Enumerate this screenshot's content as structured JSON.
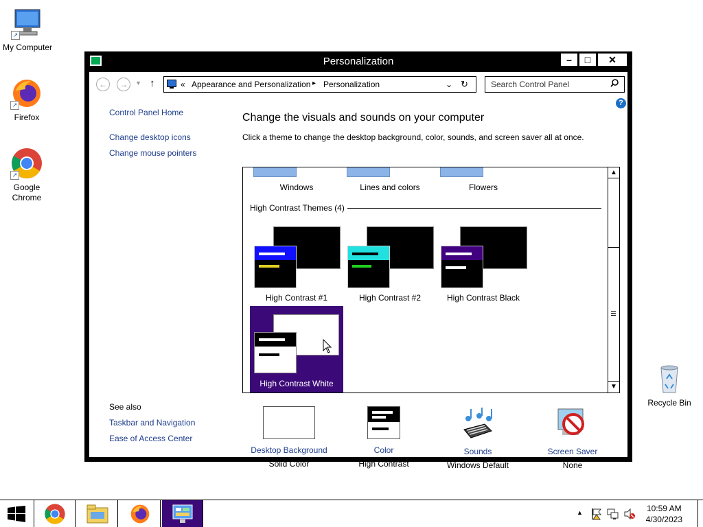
{
  "desktop": {
    "icons": [
      {
        "label": "My Computer"
      },
      {
        "label": "Firefox"
      },
      {
        "label": "Google Chrome"
      },
      {
        "label": "Recycle Bin"
      }
    ]
  },
  "window": {
    "title": "Personalization",
    "controls": {
      "minimize": "–",
      "maximize": "□",
      "close": "✕"
    },
    "address": {
      "chevrons": "«",
      "crumbs": [
        "Appearance and Personalization",
        "Personalization"
      ],
      "separator": "▸"
    },
    "search_placeholder": "Search Control Panel",
    "help": "?",
    "sidebar": {
      "home": "Control Panel Home",
      "links": [
        "Change desktop icons",
        "Change mouse pointers"
      ],
      "see_also_heading": "See also",
      "see_also": [
        "Taskbar and Navigation",
        "Ease of Access Center"
      ]
    },
    "main": {
      "heading": "Change the visuals and sounds on your computer",
      "subheading": "Click a theme to change the desktop background, color, sounds, and screen saver all at once.",
      "top_themes": [
        "Windows",
        "Lines and colors",
        "Flowers"
      ],
      "hc_group_label": "High Contrast Themes (4)",
      "hc_themes": [
        {
          "name": "High Contrast #1",
          "bar_color": "#1010ff",
          "line1": "#ffffff",
          "line2": "#e0d020"
        },
        {
          "name": "High Contrast #2",
          "bar_color": "#20e0e0",
          "line1": "#000000",
          "line2": "#20d020"
        },
        {
          "name": "High Contrast Black",
          "bar_color": "#400080",
          "line1": "#ffffff",
          "line2": "#ffffff"
        },
        {
          "name": "High Contrast White",
          "selected": true
        }
      ],
      "selected_color": "#3c0a78"
    },
    "bottom": [
      {
        "title": "Desktop Background",
        "value": "Solid Color",
        "icon": "solid-color-swatch-icon"
      },
      {
        "title": "Color",
        "value": "High Contrast",
        "icon": "color-scheme-icon"
      },
      {
        "title": "Sounds",
        "value": "Windows Default",
        "icon": "sounds-icon"
      },
      {
        "title": "Screen Saver",
        "value": "None",
        "icon": "screen-saver-icon"
      }
    ]
  },
  "taskbar": {
    "time": "10:59 AM",
    "date": "4/30/2023",
    "show_hidden": "▲"
  }
}
